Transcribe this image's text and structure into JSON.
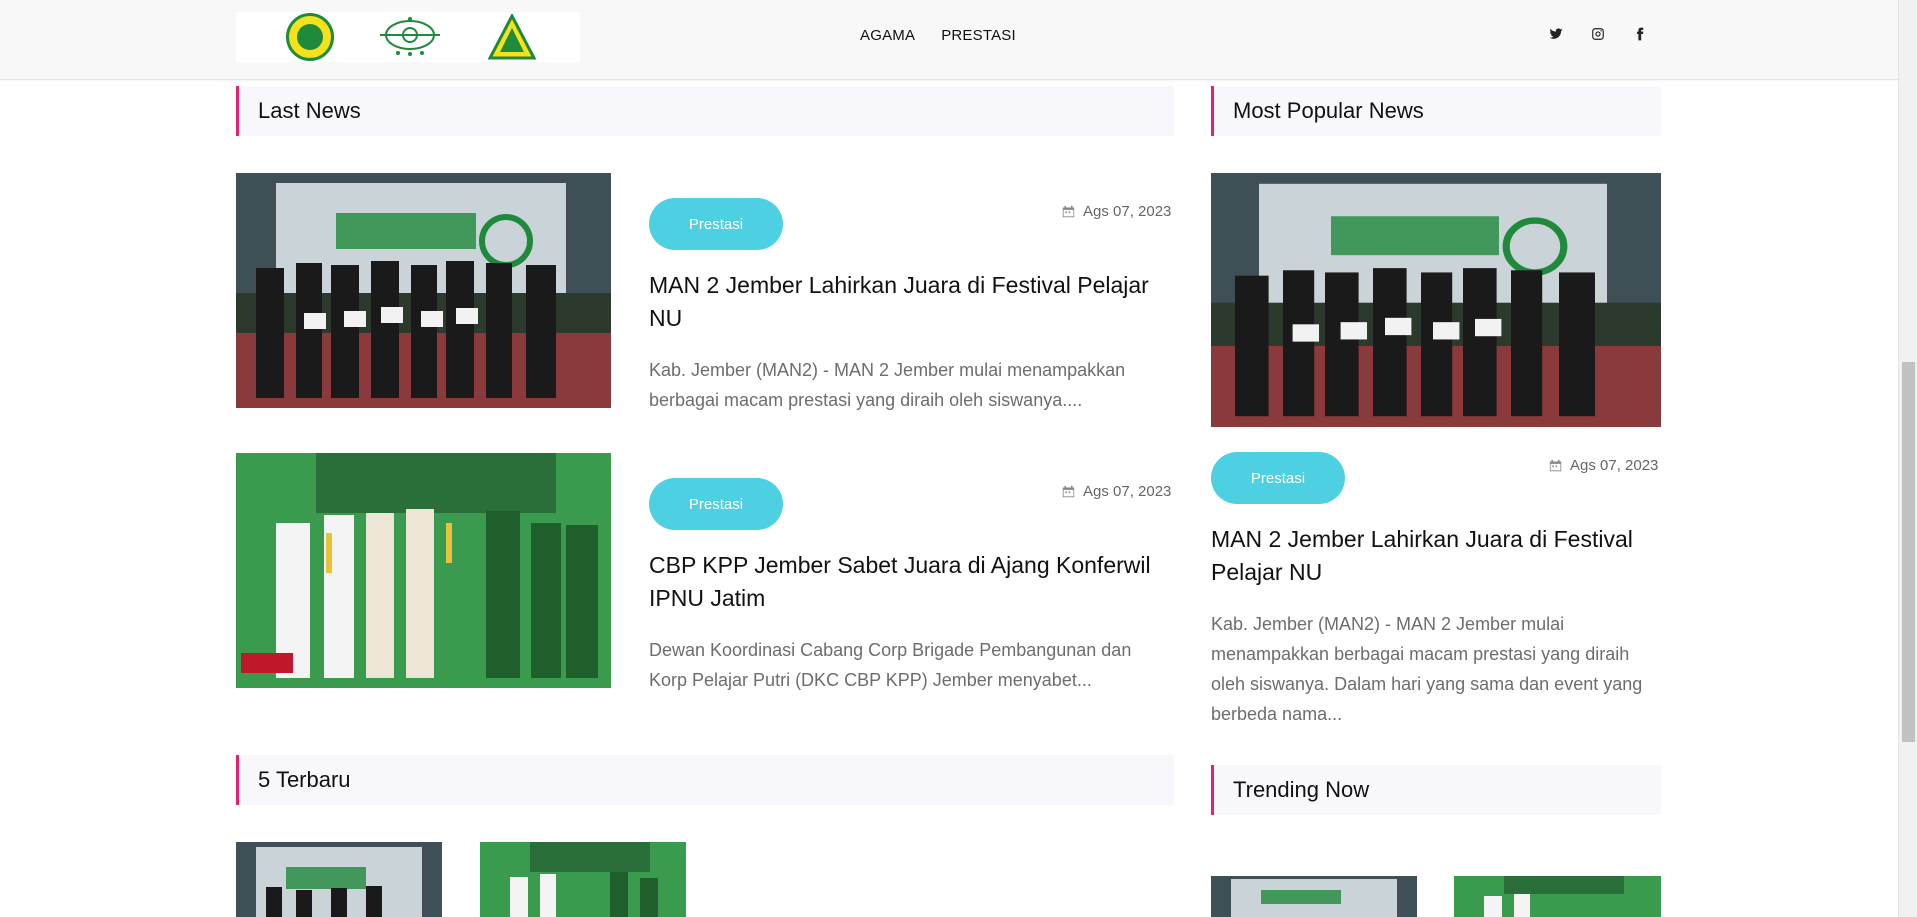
{
  "header": {
    "logos": [
      "pergunu-logo",
      "nu-logo",
      "ipnu-logo"
    ],
    "nav": [
      {
        "label": "AGAMA"
      },
      {
        "label": "PRESTASI"
      }
    ],
    "socials": [
      "twitter-icon",
      "instagram-icon",
      "facebook-icon"
    ]
  },
  "last_news": {
    "heading": "Last News",
    "articles": [
      {
        "badge": "Prestasi",
        "date": "Ags 07, 2023",
        "title": "MAN 2 Jember Lahirkan Juara di Festival Pelajar NU",
        "excerpt": "Kab. Jember (MAN2) - MAN 2 Jember mulai menampakkan berbagai macam prestasi yang diraih oleh siswanya...."
      },
      {
        "badge": "Prestasi",
        "date": "Ags 07, 2023",
        "title": "CBP KPP Jember Sabet Juara di Ajang Konferwil IPNU Jatim",
        "excerpt": "Dewan Koordinasi Cabang Corp Brigade Pembangunan dan Korp Pelajar Putri (DKC CBP KPP) Jember menyabet..."
      }
    ]
  },
  "terbaru": {
    "heading": "5 Terbaru"
  },
  "popular": {
    "heading": "Most Popular News",
    "article": {
      "badge": "Prestasi",
      "date": "Ags 07, 2023",
      "title": "MAN 2 Jember Lahirkan Juara di Festival Pelajar NU",
      "excerpt": "Kab. Jember (MAN2) - MAN 2 Jember mulai menampakkan berbagai macam prestasi yang diraih oleh siswanya. Dalam hari yang sama dan event yang berbeda nama..."
    }
  },
  "trending": {
    "heading": "Trending Now"
  },
  "colors": {
    "accent": "#e5226e",
    "badge": "#4dd0e1",
    "section_bg": "#f8f7fc"
  }
}
